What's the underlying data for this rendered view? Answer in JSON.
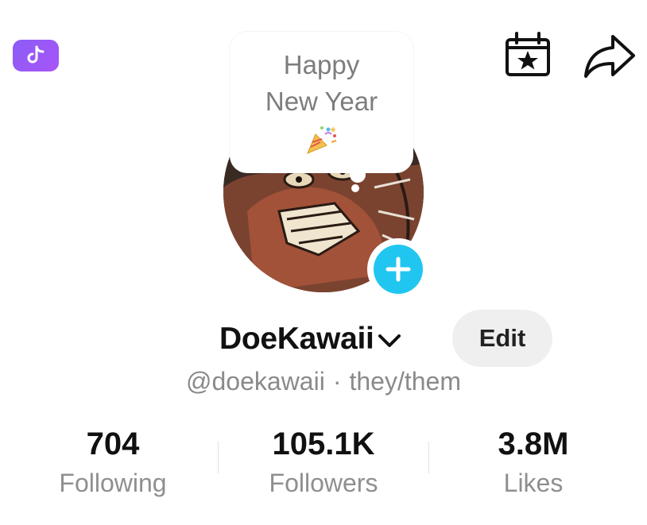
{
  "header": {
    "app_badge_icon": "tiktok-note-icon",
    "calendar_icon": "calendar-star-icon",
    "share_icon": "share-arrow-icon"
  },
  "status_bubble": {
    "line1": "Happy",
    "line2": "New Year",
    "emoji_icon": "party-popper-icon"
  },
  "profile": {
    "username": "DoeKawaii",
    "handle": "@doekawaii",
    "separator": "·",
    "pronouns": "they/them",
    "edit_label": "Edit",
    "accent_color": "#20c6f0"
  },
  "stats": [
    {
      "value": "704",
      "label": "Following"
    },
    {
      "value": "105.1K",
      "label": "Followers"
    },
    {
      "value": "3.8M",
      "label": "Likes"
    }
  ]
}
